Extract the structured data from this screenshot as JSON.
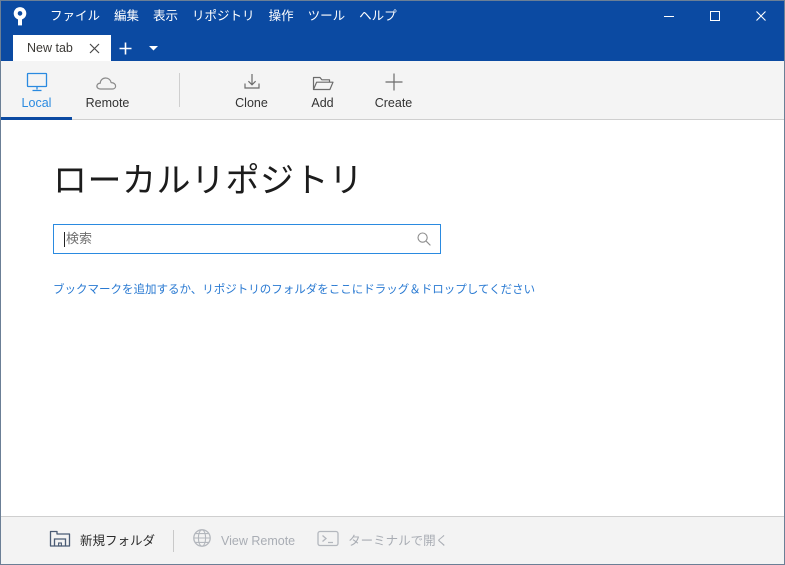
{
  "app": {
    "logo_icon": "sourcetree-logo-icon",
    "accent_blue": "#0b4aa2",
    "link_blue": "#2a7ad2",
    "active_blue": "#2a8ae0"
  },
  "menubar": {
    "items": [
      {
        "label": "ファイル",
        "name": "menu-file"
      },
      {
        "label": "編集",
        "name": "menu-edit"
      },
      {
        "label": "表示",
        "name": "menu-view"
      },
      {
        "label": "リポジトリ",
        "name": "menu-repository"
      },
      {
        "label": "操作",
        "name": "menu-actions"
      },
      {
        "label": "ツール",
        "name": "menu-tools"
      },
      {
        "label": "ヘルプ",
        "name": "menu-help"
      }
    ]
  },
  "window_controls": {
    "minimize": "−",
    "maximize": "□",
    "close": "✕"
  },
  "tabs": {
    "items": [
      {
        "label": "New tab",
        "close_label": "✕"
      }
    ],
    "new_tab_label": "+",
    "dropdown_label": "▾"
  },
  "toolbar": {
    "items": [
      {
        "label": "Local",
        "icon": "monitor-icon",
        "active": true
      },
      {
        "label": "Remote",
        "icon": "cloud-icon",
        "active": false
      },
      {
        "label": "Clone",
        "icon": "download-arrow-icon",
        "active": false
      },
      {
        "label": "Add",
        "icon": "open-folder-icon",
        "active": false
      },
      {
        "label": "Create",
        "icon": "plus-icon",
        "active": false
      }
    ]
  },
  "main": {
    "title": "ローカルリポジトリ",
    "search": {
      "placeholder": "検索",
      "value": "",
      "icon": "search-icon"
    },
    "hint": "ブックマークを追加するか、リポジトリのフォルダをここにドラッグ＆ドロップしてください"
  },
  "bottombar": {
    "items": [
      {
        "label": "新規フォルダ",
        "icon": "new-folder-icon",
        "disabled": false
      },
      {
        "label": "View Remote",
        "icon": "globe-icon",
        "disabled": true
      },
      {
        "label": "ターミナルで開く",
        "icon": "terminal-icon",
        "disabled": true
      }
    ]
  }
}
